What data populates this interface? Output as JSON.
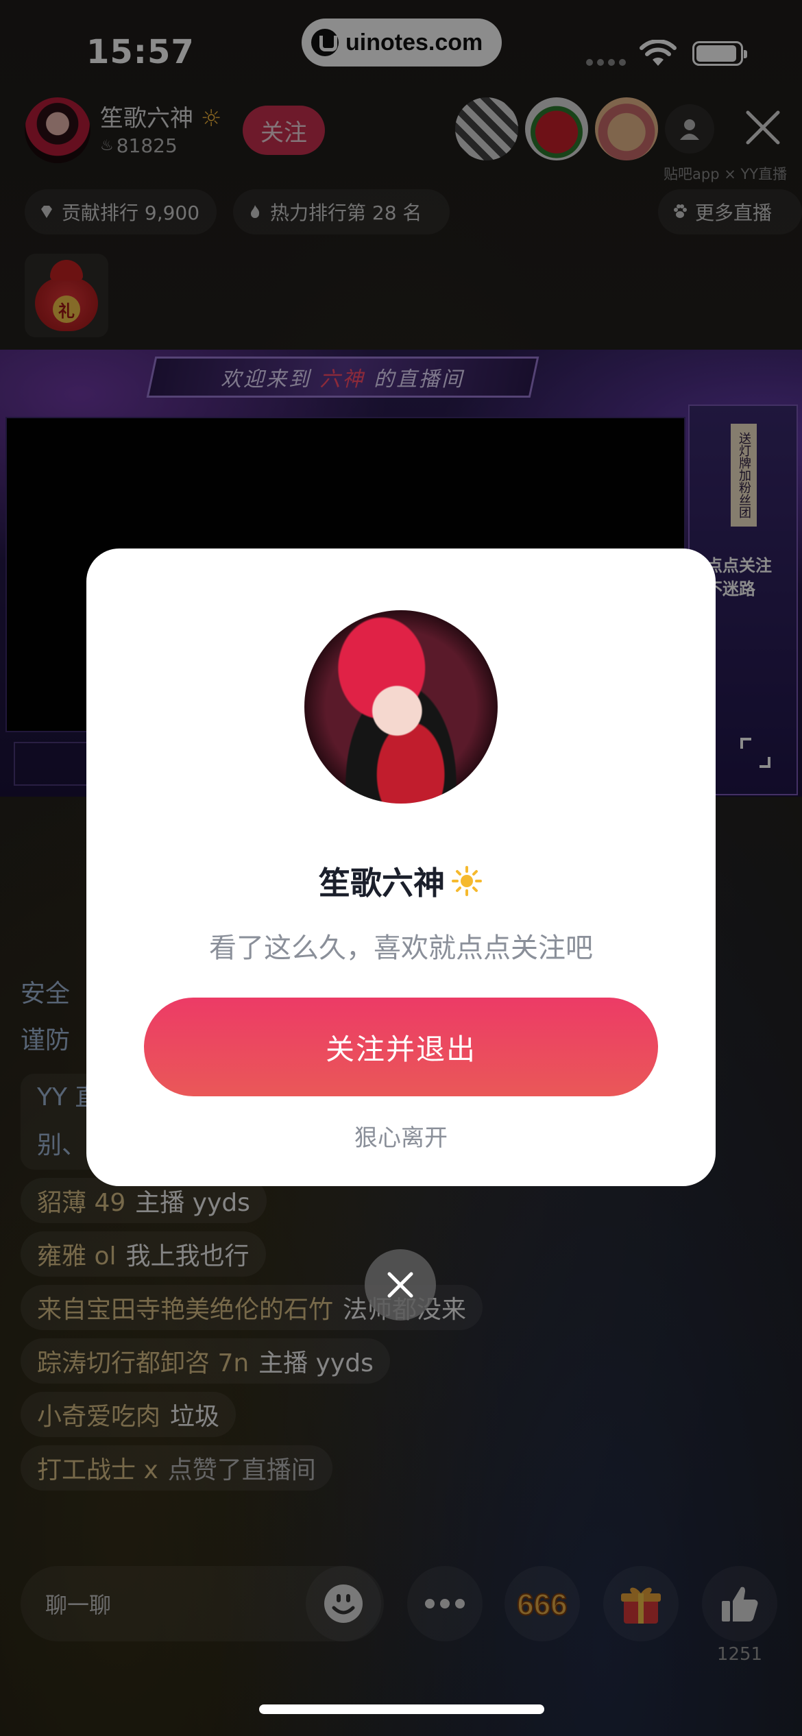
{
  "status_bar": {
    "time": "15:57",
    "url": "uinotes.com"
  },
  "host": {
    "name": "笙歌六神",
    "heat": "81825",
    "follow_label": "关注"
  },
  "header": {
    "brand_text": "贴吧app × YY直播"
  },
  "chips": {
    "rank": "贡献排行 9,900",
    "heat_rank": "热力排行第 28 名",
    "more_live": "更多直播"
  },
  "stream": {
    "banner_prefix": "欢迎来到",
    "banner_name": "六神",
    "banner_suffix": "的直播间",
    "side_vertical": "送灯牌加粉丝团",
    "side_follow_1": "点点关注",
    "side_follow_2": "不迷路"
  },
  "chat": {
    "notice_1": "安全",
    "notice_2": "谨防",
    "notice_3": "YY 直",
    "notice_4": "别、",
    "messages": [
      {
        "user": "貂薄 49",
        "text": "主播 yyds"
      },
      {
        "user": "雍雅 ol",
        "text": "我上我也行"
      },
      {
        "user": "来自宝田寺艳美绝伦的石竹",
        "text": "法师都没来"
      },
      {
        "user": "踪涛切行都卸咨 7n",
        "text": "主播 yyds"
      },
      {
        "user": "小奇爱吃肉",
        "text": "垃圾"
      },
      {
        "user": "打工战士 x",
        "text": "点赞了直播间"
      }
    ]
  },
  "bottom_bar": {
    "input_placeholder": "聊一聊",
    "like_count": "1251"
  },
  "modal": {
    "name": "笙歌六神",
    "subtitle": "看了这么久，喜欢就点点关注吧",
    "cta": "关注并退出",
    "leave": "狠心离开"
  },
  "colors": {
    "accent": "#ea4060",
    "chat_user": "#d9c087",
    "modal_bg": "#ffffff"
  }
}
